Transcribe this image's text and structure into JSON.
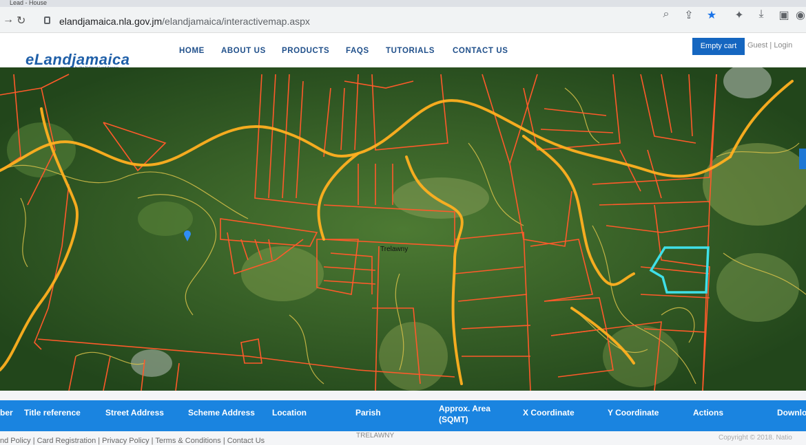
{
  "browser": {
    "url_host": "elandjamaica.nla.gov.jm",
    "url_path": "/elandjamaica/interactivemap.aspx",
    "tab_fragment": "Lead - House"
  },
  "site": {
    "logo_text": "eLandjamaica",
    "logo_subtitle": "powered by the National Land Agency",
    "nav": [
      "HOME",
      "ABOUT US",
      "PRODUCTS",
      "FAQS",
      "TUTORIALS",
      "CONTACT US"
    ],
    "cart_label": "Empty cart",
    "guest_text": "Guest | Login"
  },
  "map": {
    "parish_label": "Trelawny",
    "colors": {
      "parcel": "#ff5a2a",
      "road": "#ffb020",
      "contour": "#d9c24a",
      "selected": "#3fe0e8",
      "marker": "#2f8df5"
    }
  },
  "table": {
    "columns": [
      "ber",
      "Title reference",
      "Street Address",
      "Scheme Address",
      "Location",
      "Parish",
      "Approx. Area (SQMT)",
      "X Coordinate",
      "Y Coordinate",
      "Actions",
      "Downlo"
    ],
    "row_parish": "TRELAWNY"
  },
  "footer": {
    "text": "nd Policy | Card Registration | Privacy Policy | Terms & Conditions | Contact Us",
    "copyright": "Copyright © 2018. Natio"
  }
}
